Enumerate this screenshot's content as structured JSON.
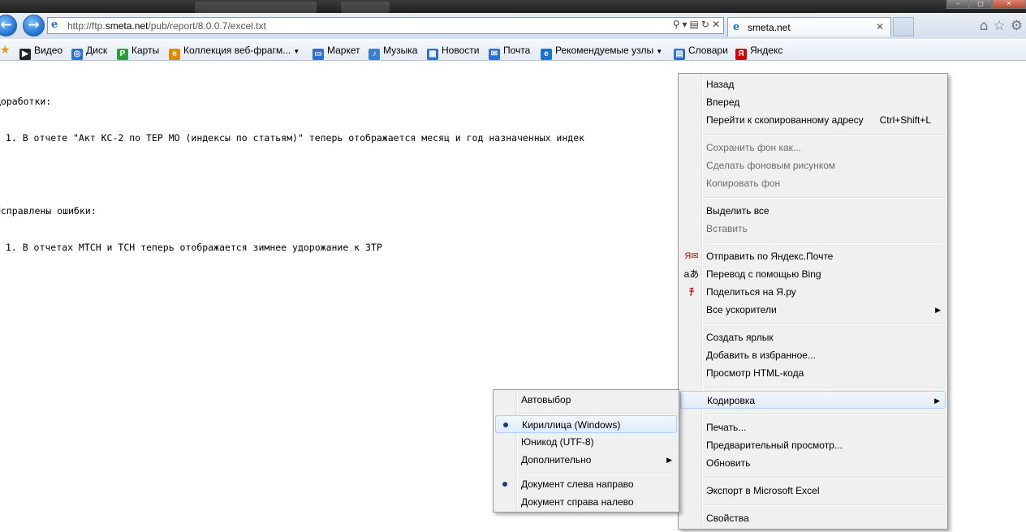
{
  "browser": {
    "address_url_prefix": "http://ftp.",
    "address_url_host": "smeta.net",
    "address_url_path": "/pub/report/8.0.0.7/excel.txt",
    "tab_title": "smeta.net",
    "window_controls": [
      "–",
      "□",
      "✕"
    ]
  },
  "favorites": [
    {
      "label": "Видео",
      "icon": "video-play-icon",
      "color": "#222222"
    },
    {
      "label": "Диск",
      "icon": "disk-icon",
      "color": "#2a6fd6"
    },
    {
      "label": "Карты",
      "icon": "maps-icon",
      "color": "#2e9e3a"
    },
    {
      "label": "Коллекция веб-фрагм...",
      "icon": "web-slice-icon",
      "color": "#e08a00"
    },
    {
      "label": "Маркет",
      "icon": "market-icon",
      "color": "#2a6fd6"
    },
    {
      "label": "Музыка",
      "icon": "music-icon",
      "color": "#3a7fd6"
    },
    {
      "label": "Новости",
      "icon": "news-icon",
      "color": "#2a6fd6"
    },
    {
      "label": "Почта",
      "icon": "mail-icon",
      "color": "#2a6fd6"
    },
    {
      "label": "Рекомендуемые узлы",
      "icon": "ie-icon",
      "color": "#1b73d1"
    },
    {
      "label": "Словари",
      "icon": "dictionary-icon",
      "color": "#2a6fd6"
    },
    {
      "label": "Яндекс",
      "icon": "yandex-icon",
      "color": "#d40000"
    }
  ],
  "content": {
    "line1": "Доработки:",
    "line2": " 1. В отчете \"Акт КС-2 по ТЕР МО (индексы по статьям)\" теперь отображается месяц и год назначенных индек",
    "line3": "Исправлены ошибки:",
    "line4": " 1. В отчетах МТСН и ТСН теперь отображается зимнее удорожание к ЗТР"
  },
  "context_menu": {
    "back": "Назад",
    "forward": "Вперед",
    "goto_copied": "Перейти к скопированному адресу",
    "goto_copied_shortcut": "Ctrl+Shift+L",
    "save_bg": "Сохранить фон как...",
    "set_bg": "Сделать фоновым рисунком",
    "copy_bg": "Копировать фон",
    "select_all": "Выделить все",
    "paste": "Вставить",
    "send_yandex_mail": "Отправить по Яндекс.Почте",
    "translate_bing": "Перевод с помощью Bing",
    "share_ya": "Поделиться на Я.ру",
    "all_accelerators": "Все ускорители",
    "create_shortcut": "Создать ярлык",
    "add_favorites": "Добавить в избранное...",
    "view_source": "Просмотр HTML-кода",
    "encoding": "Кодировка",
    "print": "Печать...",
    "print_preview": "Предварительный просмотр...",
    "refresh": "Обновить",
    "export_excel": "Экспорт в Microsoft Excel",
    "properties": "Свойства"
  },
  "encoding_menu": {
    "auto": "Автовыбор",
    "cyrillic": "Кириллица (Windows)",
    "unicode": "Юникод (UTF-8)",
    "more": "Дополнительно",
    "ltr": "Документ слева направо",
    "rtl": "Документ справа налево"
  }
}
